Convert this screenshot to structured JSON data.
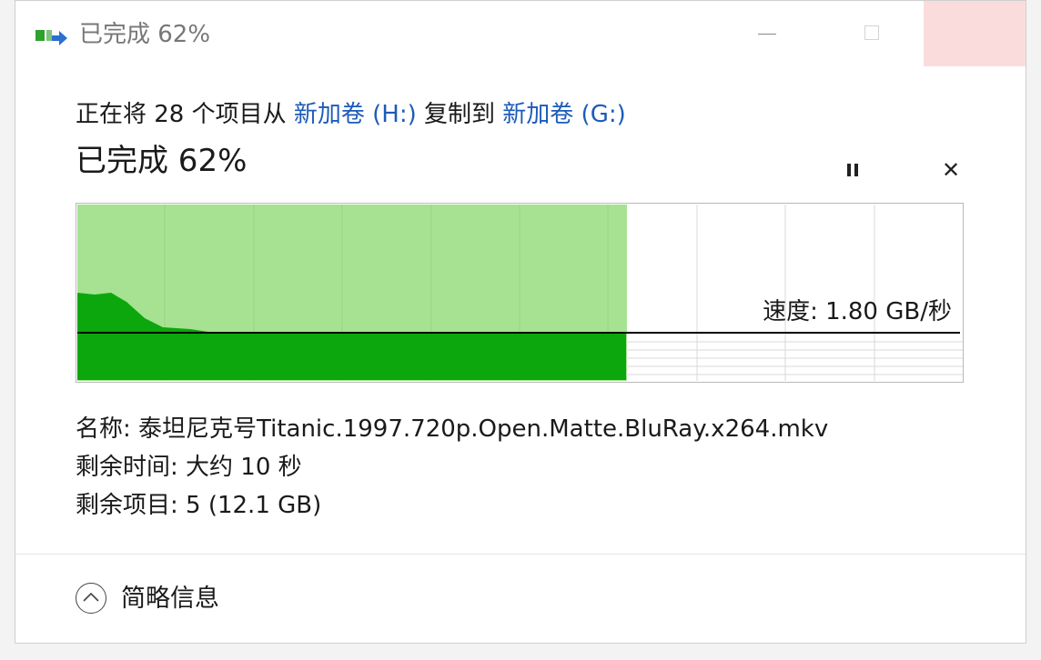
{
  "window": {
    "title": "已完成 62%",
    "app_icon": "copy-transfer-icon",
    "controls": {
      "minimize": "minimize-icon",
      "maximize": "maximize-icon",
      "close": "close-icon"
    }
  },
  "copy": {
    "prefix": "正在将 28 个项目从 ",
    "source": "新加卷 (H:)",
    "middle": " 复制到 ",
    "destination": "新加卷 (G:)"
  },
  "progress": {
    "heading": "已完成 62%",
    "percent": 62,
    "pause_icon": "pause-icon",
    "cancel_icon": "cancel-icon",
    "cancel_glyph": "✕"
  },
  "graph": {
    "speed_label": "速度: 1.80 GB/秒",
    "colors": {
      "completed_area": "#a6e291",
      "speed_fill": "#0ca70c",
      "speed_line": "#000000",
      "grid": "#d9d9d9"
    }
  },
  "details": {
    "name": "名称: 泰坦尼克号Titanic.1997.720p.Open.Matte.BluRay.x264.mkv",
    "time_remaining": "剩余时间: 大约 10 秒",
    "items_remaining": "剩余项目: 5 (12.1 GB)"
  },
  "footer": {
    "toggle_label": "简略信息",
    "toggle_icon": "chevron-up-icon"
  }
}
